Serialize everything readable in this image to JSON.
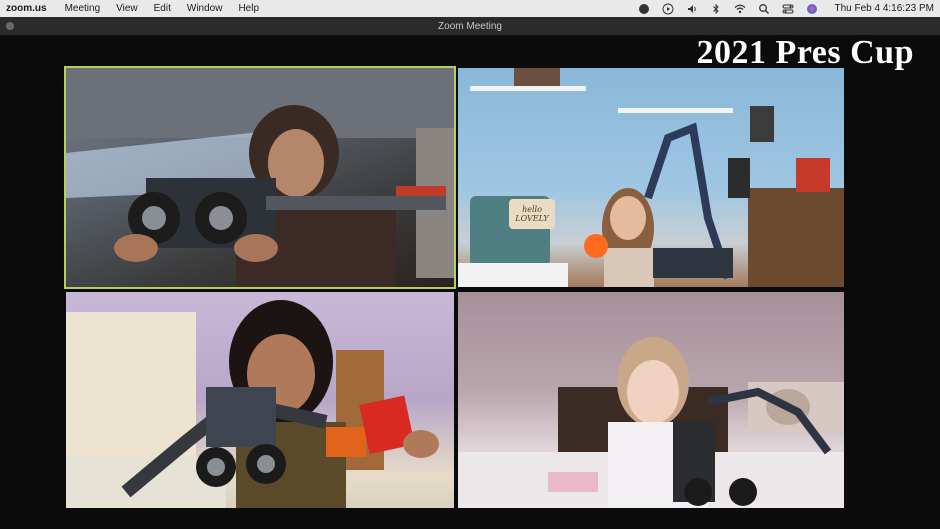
{
  "menubar": {
    "app_name": "zoom.us",
    "menus": [
      "Meeting",
      "View",
      "Edit",
      "Window",
      "Help"
    ],
    "status_icons": [
      "creative-cloud-icon",
      "play-icon",
      "volume-icon",
      "bluetooth-icon",
      "wifi-icon",
      "search-icon",
      "control-center-icon",
      "siri-icon"
    ],
    "clock": "Thu Feb 4  4:16:23 PM"
  },
  "window": {
    "title": "Zoom Meeting"
  },
  "overlay": {
    "title": "2021 Pres Cup"
  },
  "tiles": [
    {
      "active": true
    },
    {
      "sign_line1": "hello",
      "sign_line2": "LOVELY"
    },
    {},
    {}
  ],
  "colors": {
    "active_border": "#b6cf5a",
    "menubar": "#e9e9e9",
    "titlebar": "#2b2b2b",
    "background": "#0b0b0b"
  }
}
